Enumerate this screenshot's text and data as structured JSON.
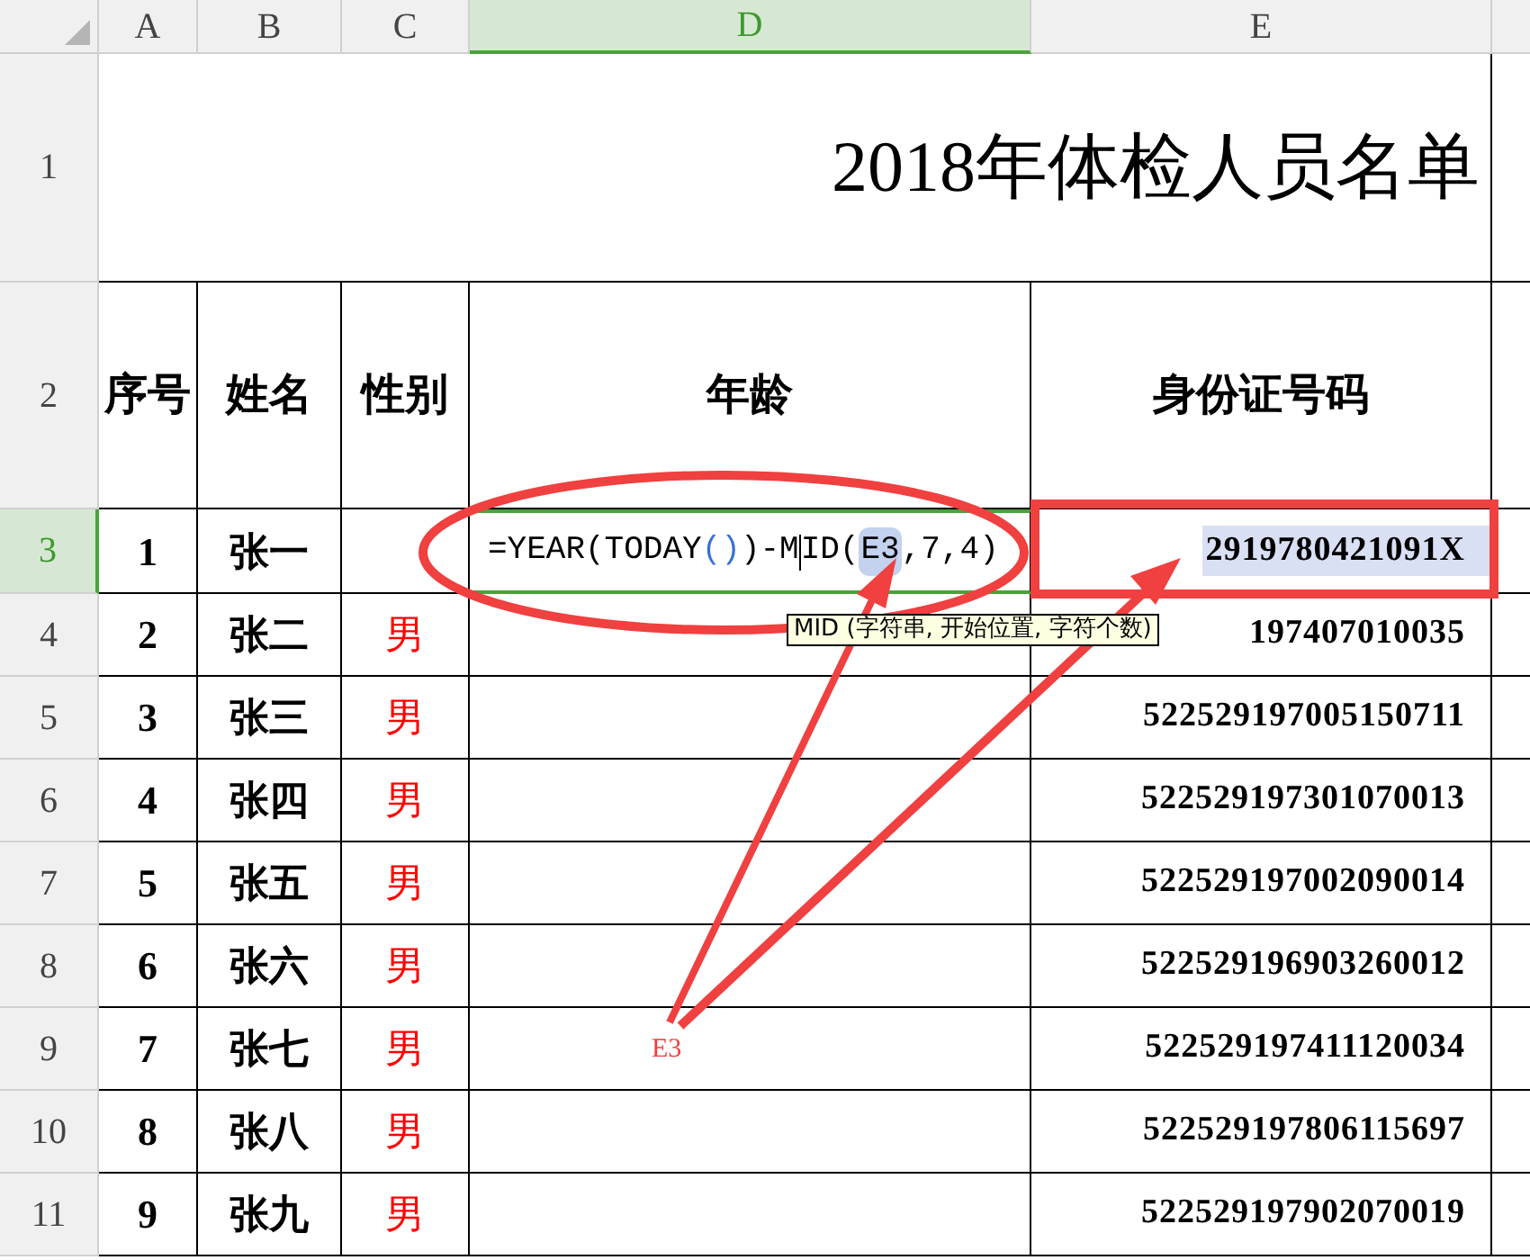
{
  "columns": [
    {
      "label": "A",
      "selected": false
    },
    {
      "label": "B",
      "selected": false
    },
    {
      "label": "C",
      "selected": false
    },
    {
      "label": "D",
      "selected": true
    },
    {
      "label": "E",
      "selected": false
    }
  ],
  "title": {
    "row": "1",
    "text": "2018年体检人员名单"
  },
  "header": {
    "row": "2",
    "cells": [
      "序号",
      "姓名",
      "性别",
      "年龄",
      "身份证号码"
    ]
  },
  "rows": [
    {
      "row": "3",
      "selected": true,
      "no": "1",
      "name": "张一",
      "id": "2919780421091X",
      "formula": [
        {
          "kind": "text",
          "text": "=YEAR(TODAY"
        },
        {
          "kind": "paren",
          "text": "()"
        },
        {
          "kind": "text",
          "text": ")-M"
        },
        {
          "kind": "caret"
        },
        {
          "kind": "text",
          "text": "ID("
        },
        {
          "kind": "ref",
          "text": "E3"
        },
        {
          "kind": "text",
          "text": ",7,4)"
        }
      ]
    },
    {
      "row": "4",
      "selected": false,
      "no": "2",
      "name": "张二",
      "gender": "男",
      "id": "197407010035"
    },
    {
      "row": "5",
      "selected": false,
      "no": "3",
      "name": "张三",
      "gender": "男",
      "id": "522529197005150711"
    },
    {
      "row": "6",
      "selected": false,
      "no": "4",
      "name": "张四",
      "gender": "男",
      "id": "522529197301070013"
    },
    {
      "row": "7",
      "selected": false,
      "no": "5",
      "name": "张五",
      "gender": "男",
      "id": "522529197002090014"
    },
    {
      "row": "8",
      "selected": false,
      "no": "6",
      "name": "张六",
      "gender": "男",
      "id": "522529196903260012"
    },
    {
      "row": "9",
      "selected": false,
      "no": "7",
      "name": "张七",
      "gender": "男",
      "id": "522529197411120034"
    },
    {
      "row": "10",
      "selected": false,
      "no": "8",
      "name": "张八",
      "gender": "男",
      "id": "522529197806115697"
    },
    {
      "row": "11",
      "selected": false,
      "no": "9",
      "name": "张九",
      "gender": "男",
      "id": "522529197902070019"
    }
  ],
  "tooltip": "MID (字符串, 开始位置, 字符个数)",
  "annotation_label": "E3"
}
